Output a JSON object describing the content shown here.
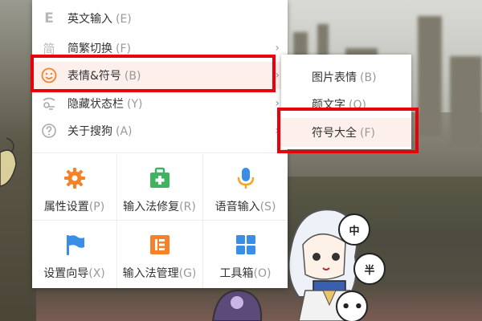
{
  "menu": {
    "items": [
      {
        "label": "英文输入",
        "shortcut": "(E)",
        "icon": "letter-e-icon",
        "has_submenu": false
      },
      {
        "label": "简繁切换",
        "shortcut": "(F)",
        "icon": "traditional-char-icon",
        "has_submenu": true
      },
      {
        "label": "表情&符号",
        "shortcut": "(B)",
        "icon": "smiley-icon",
        "has_submenu": true,
        "highlighted": true
      },
      {
        "label": "隐藏状态栏",
        "shortcut": "(Y)",
        "icon": "hide-statusbar-icon",
        "has_submenu": true
      },
      {
        "label": "关于搜狗",
        "shortcut": "(A)",
        "icon": "question-circle-icon",
        "has_submenu": true
      }
    ],
    "grid": [
      {
        "label": "属性设置",
        "shortcut": "(P)",
        "icon": "gear-icon"
      },
      {
        "label": "输入法修复",
        "shortcut": "(R)",
        "icon": "repair-kit-icon"
      },
      {
        "label": "语音输入",
        "shortcut": "(S)",
        "icon": "microphone-icon"
      },
      {
        "label": "设置向导",
        "shortcut": "(X)",
        "icon": "flag-icon"
      },
      {
        "label": "输入法管理",
        "shortcut": "(G)",
        "icon": "ime-manage-icon"
      },
      {
        "label": "工具箱",
        "shortcut": "(O)",
        "icon": "toolbox-grid-icon"
      }
    ]
  },
  "submenu": {
    "items": [
      {
        "label": "图片表情",
        "shortcut": "(B)"
      },
      {
        "label": "颜文字",
        "shortcut": "(Q)"
      },
      {
        "label": "符号大全",
        "shortcut": "(F)",
        "highlighted": true
      }
    ]
  },
  "background": {
    "bubbles": [
      "中",
      "半",
      ""
    ]
  },
  "colors": {
    "accent_orange": "#f5822b",
    "green": "#3fb35f",
    "blue": "#3a8ee6",
    "highlight_bg": "#fdf0ec",
    "annotation_red": "#e8000b"
  }
}
